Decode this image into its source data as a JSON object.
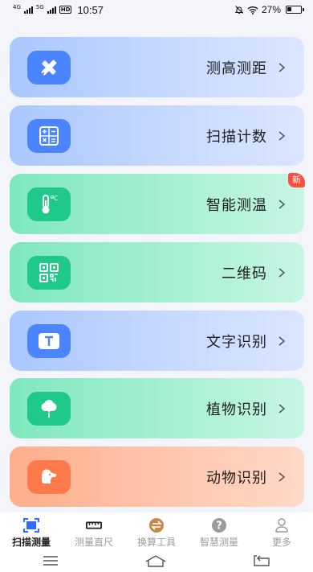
{
  "status_bar": {
    "network1": "4G",
    "network2": "5G",
    "hd": "HD",
    "time": "10:57",
    "battery": "27%"
  },
  "cards": [
    {
      "label": "测高测距",
      "icon": "ruler-pencil-icon",
      "theme": "blue"
    },
    {
      "label": "扫描计数",
      "icon": "calculator-icon",
      "theme": "blue"
    },
    {
      "label": "智能测温",
      "icon": "thermometer-icon",
      "theme": "green",
      "badge": "新"
    },
    {
      "label": "二维码",
      "icon": "qr-code-icon",
      "theme": "green"
    },
    {
      "label": "文字识别",
      "icon": "text-icon",
      "theme": "blue"
    },
    {
      "label": "植物识别",
      "icon": "tree-icon",
      "theme": "green"
    },
    {
      "label": "动物识别",
      "icon": "dog-icon",
      "theme": "orange"
    }
  ],
  "tabs": [
    {
      "label": "扫描测量",
      "icon": "scan-icon",
      "active": true
    },
    {
      "label": "测量直尺",
      "icon": "ruler-icon",
      "active": false
    },
    {
      "label": "换算工具",
      "icon": "convert-icon",
      "active": false
    },
    {
      "label": "智慧测量",
      "icon": "question-icon",
      "active": false
    },
    {
      "label": "更多",
      "icon": "user-icon",
      "active": false
    }
  ],
  "colors": {
    "blue_icon": "#4a84ff",
    "green_icon": "#1fc98a",
    "orange_icon": "#ff7a4b",
    "badge": "#ff4d3d"
  }
}
